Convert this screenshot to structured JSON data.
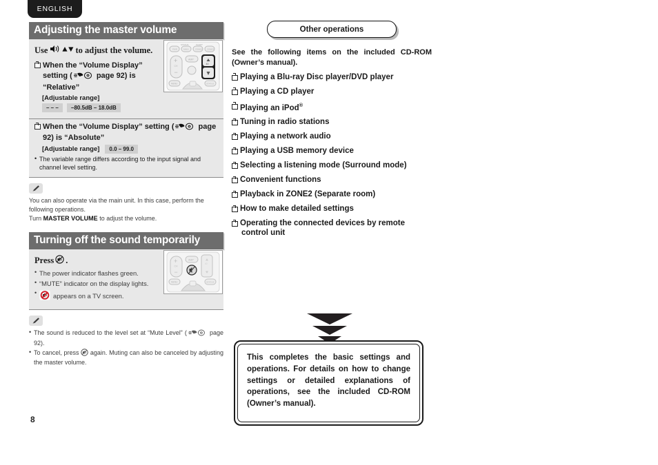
{
  "lang_tab": {
    "label": "ENGLISH"
  },
  "page_number": "8",
  "left": {
    "section1": {
      "heading": "Adjusting the master volume",
      "use_line_prefix": "Use",
      "use_line_suffix": "to adjust the volume.",
      "speaker_icon": "volume-speaker-icon",
      "updown_icon": "up-down-arrows-icon",
      "items": [
        {
          "text_a": "When the “Volume Display” setting (",
          "ref_icon": "page-reference-hand-disc-icon",
          "text_b": " page 92) is “Relative”",
          "adjustable_label": "[Adjustable range]",
          "chips": [
            "– – –",
            "−80.5dB – 18.0dB"
          ]
        },
        {
          "text_a": "When the “Volume Display” setting (",
          "ref_icon": "page-reference-hand-disc-icon",
          "text_b": " page 92) is “Absolute”",
          "adjustable_label": "[Adjustable range]",
          "chips": [
            "0.0 – 99.0"
          ],
          "note": "The variable range differs according to the input signal and channel level setting."
        }
      ],
      "remote_image": "remote-control-volume-buttons-illustration"
    },
    "note1": {
      "icon": "pencil-note-icon",
      "line1": "You can also operate via the main unit. In this case, perform the following operations.",
      "line2_prefix": "Turn ",
      "line2_bold": "MASTER VOLUME",
      "line2_suffix": " to adjust the volume."
    },
    "section2": {
      "heading": "Turning off the sound temporarily",
      "press_prefix": "Press",
      "press_suffix": ".",
      "mute_icon": "mute-button-icon",
      "bullets": [
        "The power indicator flashes green.",
        "“MUTE” indicator on the display lights."
      ],
      "bullet_icon_line": {
        "icon": "mute-crossed-speaker-icon",
        "text": "appears on a TV screen."
      },
      "remote_image": "remote-control-mute-button-illustration"
    },
    "note2": {
      "icon": "pencil-note-icon",
      "items": [
        {
          "text_a": "The sound is reduced to the level set at “Mute Level” (",
          "ref_icon": "page-reference-hand-disc-icon",
          "text_b": " page 92)."
        },
        {
          "text_a": "To cancel, press ",
          "mute_icon": "mute-button-icon",
          "text_b": " again. Muting can also be canceled by adjusting the master volume."
        }
      ]
    }
  },
  "right": {
    "pill_label": "Other operations",
    "intro": "See the following items on the included CD-ROM (Owner’s manual).",
    "operations": [
      {
        "label": "Playing a Blu-ray Disc player/DVD player"
      },
      {
        "label": "Playing a CD player"
      },
      {
        "label": "Playing an iPod",
        "sup": "®"
      },
      {
        "label": "Tuning in radio stations"
      },
      {
        "label": "Playing a network audio"
      },
      {
        "label": "Playing a USB memory device"
      },
      {
        "label": "Selecting a listening mode (Surround mode)"
      },
      {
        "label": "Convenient functions"
      },
      {
        "label": "Playback in ZONE2 (Separate room)"
      },
      {
        "label": "How to make detailed settings"
      },
      {
        "label": "Operating the connected devices by remote",
        "line2": "control unit"
      }
    ],
    "arrows_icon": "down-triangles-icon",
    "completion": {
      "text": "This completes the basic settings and operations. For details on how to change settings or detailed explanations of operations, see the included CD-ROM (Owner’s manual)."
    }
  },
  "colors": {
    "header_bar": "#6d6d6d",
    "section_body": "#e8e8e8",
    "tab_bg": "#1c1c1c",
    "chip_bg": "#cfcfcf",
    "mute_red": "#d0202a"
  }
}
